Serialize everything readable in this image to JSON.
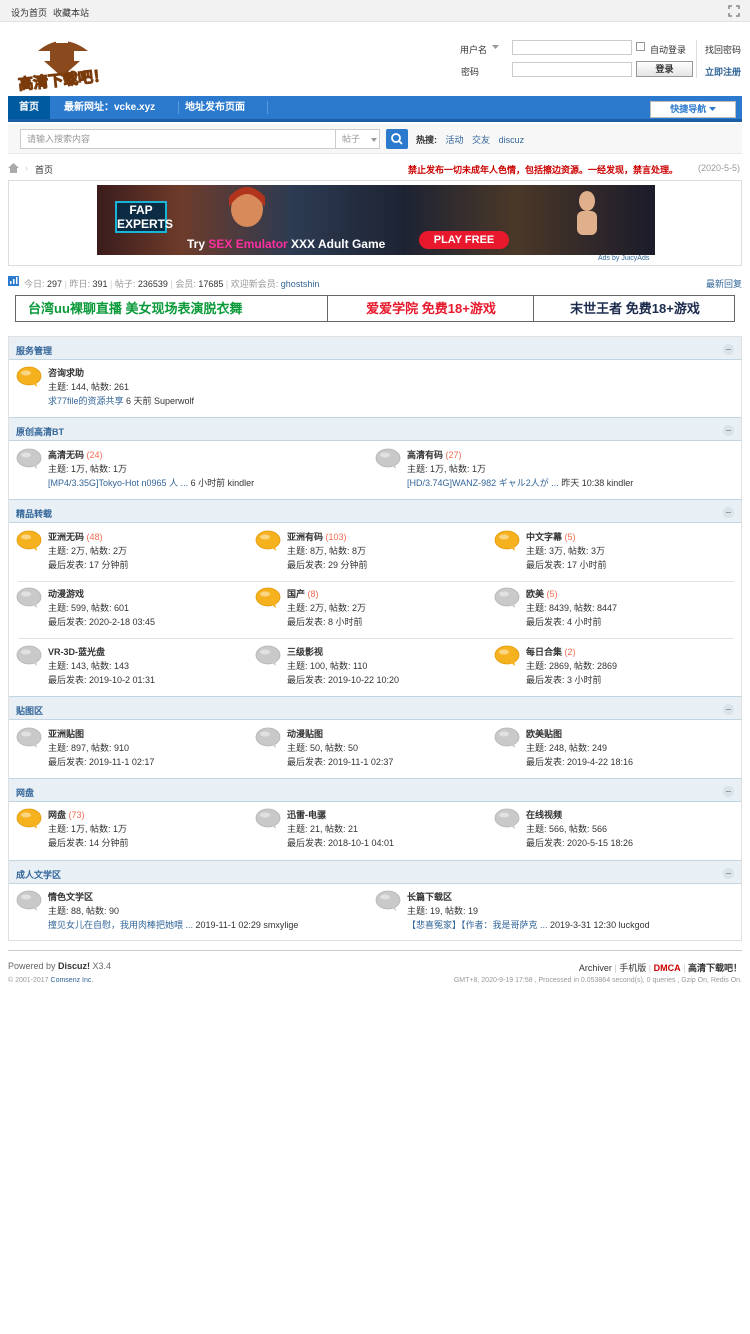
{
  "topbar": {
    "set_home": "设为首页",
    "bookmark": "收藏本站"
  },
  "logo": {
    "text": "高清下载吧！"
  },
  "login": {
    "username_label": "用户名",
    "password_label": "密码",
    "auto_login": "自动登录",
    "login_btn": "登录",
    "find_pwd": "找回密码",
    "register": "立即注册"
  },
  "nav": {
    "items": [
      "首页",
      "最新网址：vcke.xyz",
      "地址发布页面"
    ],
    "quick_nav": "快捷导航"
  },
  "search": {
    "placeholder": "请输入搜索内容",
    "type": "帖子",
    "hot_label": "热搜:",
    "hot": [
      "活动",
      "交友",
      "discuz"
    ]
  },
  "breadcrumb": {
    "home": "首页"
  },
  "notice": {
    "text": "禁止发布一切未成年人色情，包括擦边资源。一经发现，禁言处理。",
    "date": "(2020-5-5)"
  },
  "ad": {
    "brand": "FAP EXPERTS",
    "tagline_prefix": "Try ",
    "tagline_highlight": "SEX Emulator",
    "tagline_suffix": " XXX Adult Game",
    "play": "PLAY FREE",
    "by": "Ads by JuicyAds"
  },
  "stats": {
    "today_label": "今日:",
    "today": "297",
    "yesterday_label": "昨日:",
    "yesterday": "391",
    "posts_label": "帖子:",
    "posts": "236539",
    "members_label": "会员:",
    "members": "17685",
    "welcome": "欢迎新会员:",
    "newuser": "ghostshin",
    "latest": "最新回复"
  },
  "promo": [
    "台湾uu裸聊直播 美女现场表演脱衣舞",
    "爱爱学院 免费18+游戏",
    "末世王者 免费18+游戏"
  ],
  "colors": {
    "accent": "#2b7acd",
    "link": "#336699",
    "new_count": "#f26c4f",
    "notice": "#cc0000",
    "promo1": "#0a9a3a",
    "promo2": "#e8192c",
    "promo3": "#1b2a4d"
  },
  "categories": [
    {
      "title": "服务管理",
      "forums": [
        {
          "name": "咨询求助",
          "count": "",
          "new": true,
          "l2": "主题: 144, 帖数: 261",
          "link": "求77file的资源共享",
          "tail": " 6 天前 Superwolf"
        }
      ]
    },
    {
      "title": "原创高清BT",
      "forums": [
        {
          "name": "高清无码",
          "count": "(24)",
          "new": false,
          "l2": "主题: 1万, 帖数: 1万",
          "link": "[MP4/3.35G]Tokyo-Hot n0965 人 ...",
          "tail": " 6 小时前 kindler"
        },
        {
          "name": "高清有码",
          "count": "(27)",
          "new": false,
          "l2": "主题: 1万, 帖数: 1万",
          "link": "[HD/3.74G]WANZ-982 ギャル2人が ...",
          "tail": " 昨天 10:38 kindler"
        }
      ]
    },
    {
      "title": "精品转载",
      "forums": [
        {
          "name": "亚洲无码",
          "count": "(48)",
          "new": true,
          "l2": "主题: 2万, 帖数: 2万",
          "l3": "最后发表: 17 分钟前"
        },
        {
          "name": "亚洲有码",
          "count": "(103)",
          "new": true,
          "l2": "主题: 8万, 帖数: 8万",
          "l3": "最后发表: 29 分钟前"
        },
        {
          "name": "中文字幕",
          "count": "(5)",
          "new": true,
          "l2": "主题: 3万, 帖数: 3万",
          "l3": "最后发表: 17 小时前"
        },
        {
          "name": "动漫游戏",
          "count": "",
          "new": false,
          "l2": "主题: 599, 帖数: 601",
          "l3": "最后发表: 2020-2-18 03:45"
        },
        {
          "name": "国产",
          "count": "(8)",
          "new": true,
          "l2": "主题: 2万, 帖数: 2万",
          "l3": "最后发表: 8 小时前"
        },
        {
          "name": "欧美",
          "count": "(5)",
          "new": false,
          "l2": "主题: 8439, 帖数: 8447",
          "l3": "最后发表: 4 小时前"
        },
        {
          "name": "VR-3D-蓝光盘",
          "count": "",
          "new": false,
          "l2": "主题: 143, 帖数: 143",
          "l3": "最后发表: 2019-10-2 01:31"
        },
        {
          "name": "三级影视",
          "count": "",
          "new": false,
          "l2": "主题: 100, 帖数: 110",
          "l3": "最后发表: 2019-10-22 10:20"
        },
        {
          "name": "每日合集",
          "count": "(2)",
          "new": true,
          "l2": "主题: 2869, 帖数: 2869",
          "l3": "最后发表: 3 小时前"
        }
      ]
    },
    {
      "title": "贴图区",
      "forums": [
        {
          "name": "亚洲贴图",
          "count": "",
          "new": false,
          "l2": "主题: 897, 帖数: 910",
          "l3": "最后发表: 2019-11-1 02:17"
        },
        {
          "name": "动漫贴图",
          "count": "",
          "new": false,
          "l2": "主题: 50, 帖数: 50",
          "l3": "最后发表: 2019-11-1 02:37"
        },
        {
          "name": "欧美贴图",
          "count": "",
          "new": false,
          "l2": "主题: 248, 帖数: 249",
          "l3": "最后发表: 2019-4-22 18:16"
        }
      ]
    },
    {
      "title": "网盘",
      "forums": [
        {
          "name": "网盘",
          "count": "(73)",
          "new": true,
          "l2": "主题: 1万, 帖数: 1万",
          "l3": "最后发表: 14 分钟前"
        },
        {
          "name": "迅雷-电骡",
          "count": "",
          "new": false,
          "l2": "主题: 21, 帖数: 21",
          "l3": "最后发表: 2018-10-1 04:01"
        },
        {
          "name": "在线视频",
          "count": "",
          "new": false,
          "l2": "主题: 566, 帖数: 566",
          "l3": "最后发表: 2020-5-15 18:26"
        }
      ]
    },
    {
      "title": "成人文学区",
      "forums": [
        {
          "name": "情色文学区",
          "count": "",
          "new": false,
          "l2": "主题: 88, 帖数: 90",
          "link": "撞见女儿在自慰，我用肉棒把她喂 ...",
          "tail": " 2019-11-1 02:29 smxylige"
        },
        {
          "name": "长篇下载区",
          "count": "",
          "new": false,
          "l2": "主题: 19, 帖数: 19",
          "link": "【悲喜冤家】【作者：我是哥萨克 ...",
          "tail": " 2019-3-31 12:30 luckgod"
        }
      ]
    }
  ],
  "footer": {
    "powered": "Powered by ",
    "discuz": "Discuz!",
    "version": " X3.4",
    "copyright": "© 2001-2017 ",
    "comsenz": "Comsenz Inc.",
    "links": [
      "Archiver",
      "手机版",
      "DMCA",
      "高清下载吧！"
    ],
    "processed": "GMT+8, 2020-9-19 17:58 , Processed in 0.053864 second(s), 0 queries , Gzip On, Redis On."
  }
}
